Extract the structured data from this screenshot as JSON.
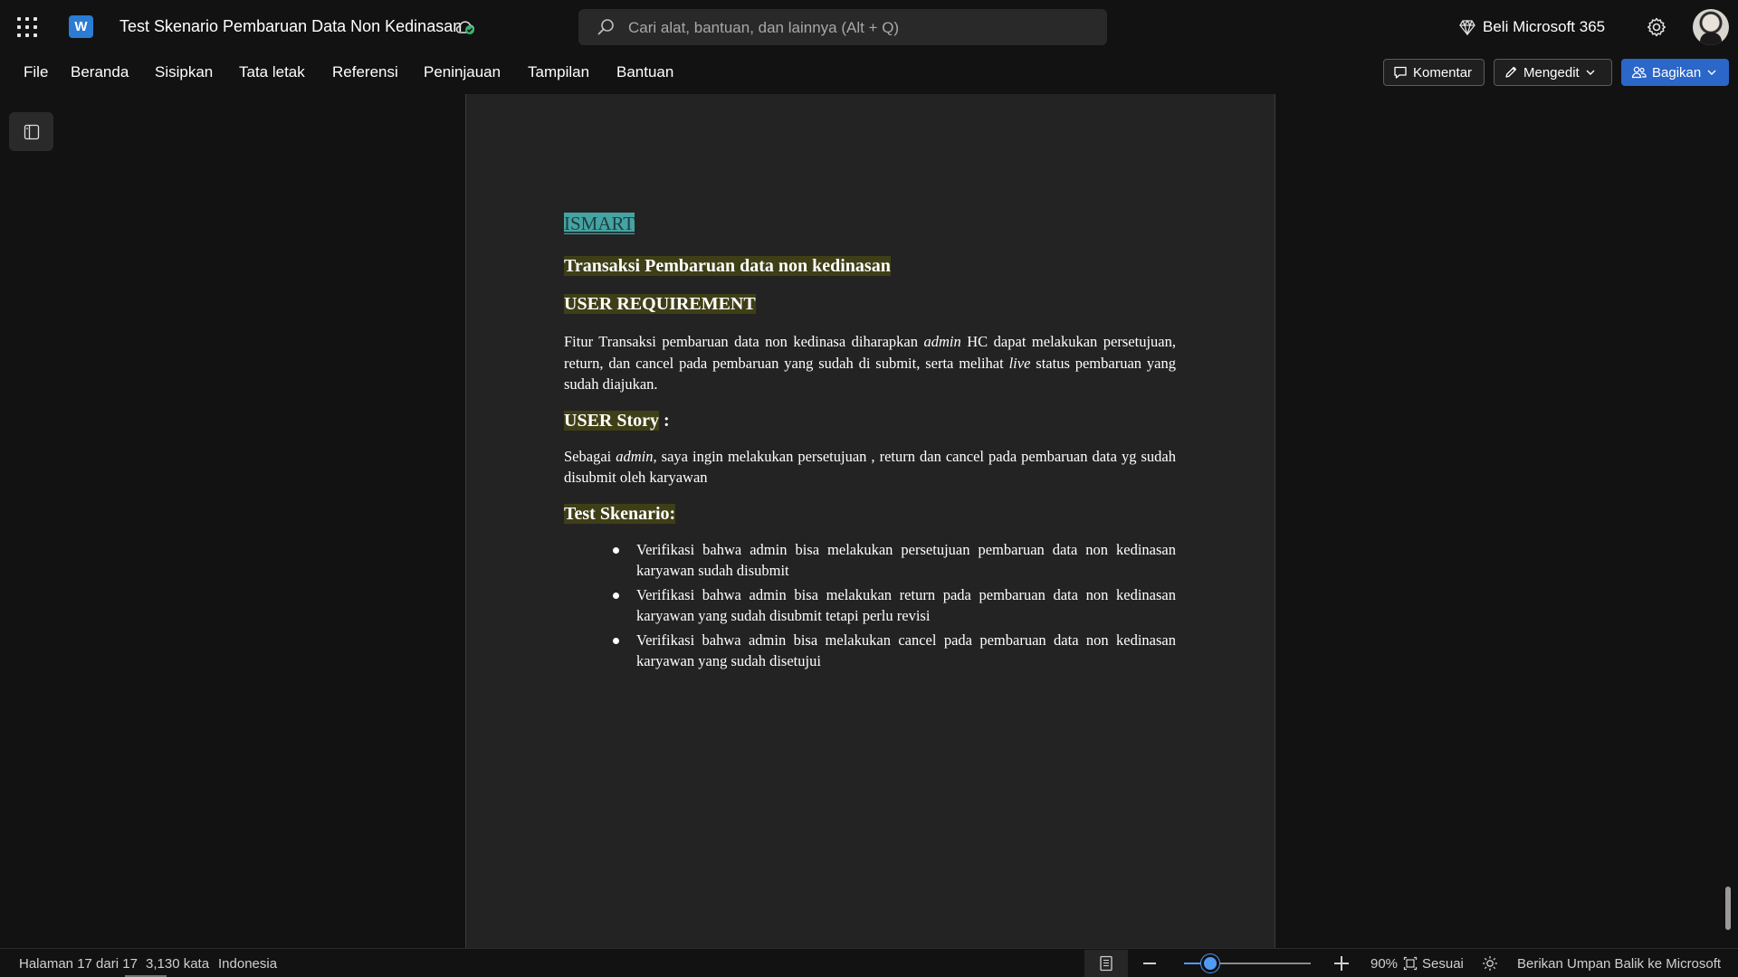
{
  "titlebar": {
    "doc_title": "Test Skenario Pembaruan Data Non Kedinasan",
    "app_logo_letter": "W",
    "search_placeholder": "Cari alat, bantuan, dan lainnya (Alt + Q)",
    "buy_label": "Beli Microsoft 365"
  },
  "menu": {
    "items": [
      "File",
      "Beranda",
      "Sisipkan",
      "Tata letak",
      "Referensi",
      "Peninjauan",
      "Tampilan",
      "Bantuan"
    ],
    "comment_label": "Komentar",
    "editing_label": "Mengedit",
    "share_label": "Bagikan"
  },
  "document": {
    "ismart": "ISMART",
    "title": "Transaksi Pembaruan data non kedinasan",
    "user_requirement_heading": "USER REQUIREMENT",
    "requirement": {
      "part1": "Fitur Transaksi pembaruan data non kedinasa diharapkan ",
      "admin": "admin",
      "part2": " HC dapat melakukan persetujuan, return, dan cancel pada pembaruan yang sudah di submit, serta melihat ",
      "live": "live",
      "part3": " status pembaruan yang sudah diajukan."
    },
    "user_story_heading": "USER Story",
    "user_story_colon": " :",
    "story": {
      "part1": "Sebagai ",
      "admin": "admin",
      "part2": ", saya ingin melakukan persetujuan , return dan cancel pada pembaruan data yg sudah disubmit oleh karyawan"
    },
    "test_scenario_heading": "Test Skenario",
    "test_scenario_colon": ":",
    "scenarios": [
      "Verifikasi bahwa admin bisa melakukan persetujuan pembaruan data non kedinasan karyawan sudah disubmit",
      "Verifikasi bahwa admin bisa melakukan return pada pembaruan data non kedinasan karyawan yang sudah disubmit tetapi perlu revisi",
      "Verifikasi bahwa admin bisa melakukan cancel pada pembaruan data non kedinasan karyawan yang sudah disetujui"
    ]
  },
  "status": {
    "page": "Halaman 17 dari 17",
    "words": "3,130 kata",
    "language": "Indonesia",
    "zoom": "90%",
    "fit_label": "Sesuai",
    "feedback_label": "Berikan Umpan Balik ke Microsoft"
  },
  "colors": {
    "accent": "#2b66c9",
    "highlight": "#3f3f17",
    "ismart_highlight": "#46a3a3",
    "page_bg": "#232323",
    "app_bg": "#121212"
  }
}
